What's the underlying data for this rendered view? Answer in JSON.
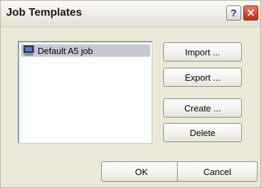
{
  "window": {
    "title": "Job Templates",
    "help_glyph": "?",
    "close_glyph": "✕"
  },
  "templates": {
    "items": [
      {
        "label": "Default A5 job",
        "icon": "computer-icon",
        "selected": true
      }
    ]
  },
  "actions": {
    "import_label": "Import ...",
    "export_label": "Export ...",
    "create_label": "Create ...",
    "delete_label": "Delete"
  },
  "dialog_buttons": {
    "ok_label": "OK",
    "cancel_label": "Cancel"
  }
}
